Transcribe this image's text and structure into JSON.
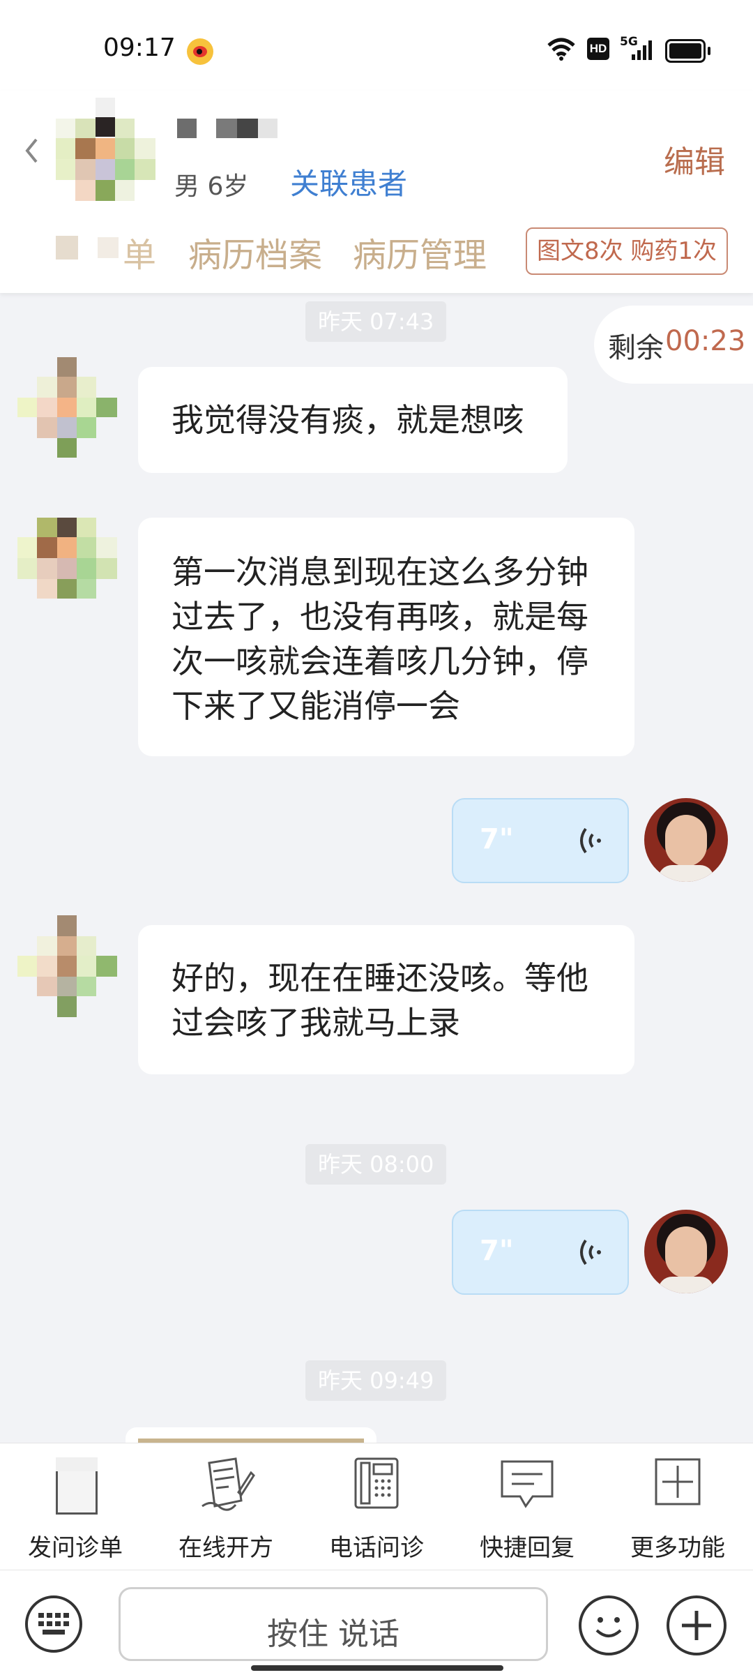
{
  "status_bar": {
    "time": "09:17",
    "network": "5G"
  },
  "header": {
    "patient_info": "男 6岁",
    "link_label": "关联患者",
    "edit_label": "编辑",
    "tabs": [
      {
        "label": "单"
      },
      {
        "label": "病历档案"
      },
      {
        "label": "病历管理"
      }
    ],
    "service_badge": "图文8次 购药1次"
  },
  "chat": {
    "remaining_label": "剩余",
    "remaining_time": "00:23",
    "timestamps": [
      "昨天 07:43",
      "昨天 08:00",
      "昨天 09:49"
    ],
    "messages": [
      {
        "from": "patient",
        "text": "我觉得没有痰，就是想咳"
      },
      {
        "from": "patient",
        "lines": [
          "第一次消息到现在这么多分钟",
          "过去了，也没有再咳，就是每",
          "次一咳就会连着咳几分钟，停",
          "下来了又能消停一会"
        ]
      },
      {
        "from": "doctor",
        "type": "voice",
        "duration": "7\""
      },
      {
        "from": "patient",
        "lines": [
          "好的，现在在睡还没咳。等他",
          "过会咳了我就马上录"
        ]
      },
      {
        "from": "doctor",
        "type": "voice",
        "duration": "7\""
      }
    ]
  },
  "toolbar": {
    "items": [
      {
        "label": "发问诊单",
        "icon": "form-icon"
      },
      {
        "label": "在线开方",
        "icon": "prescription-icon"
      },
      {
        "label": "电话问诊",
        "icon": "phone-icon"
      },
      {
        "label": "快捷回复",
        "icon": "quick-reply-icon"
      },
      {
        "label": "更多功能",
        "icon": "plus-square-icon"
      }
    ]
  },
  "input": {
    "hold_to_talk": "按住 说话"
  }
}
